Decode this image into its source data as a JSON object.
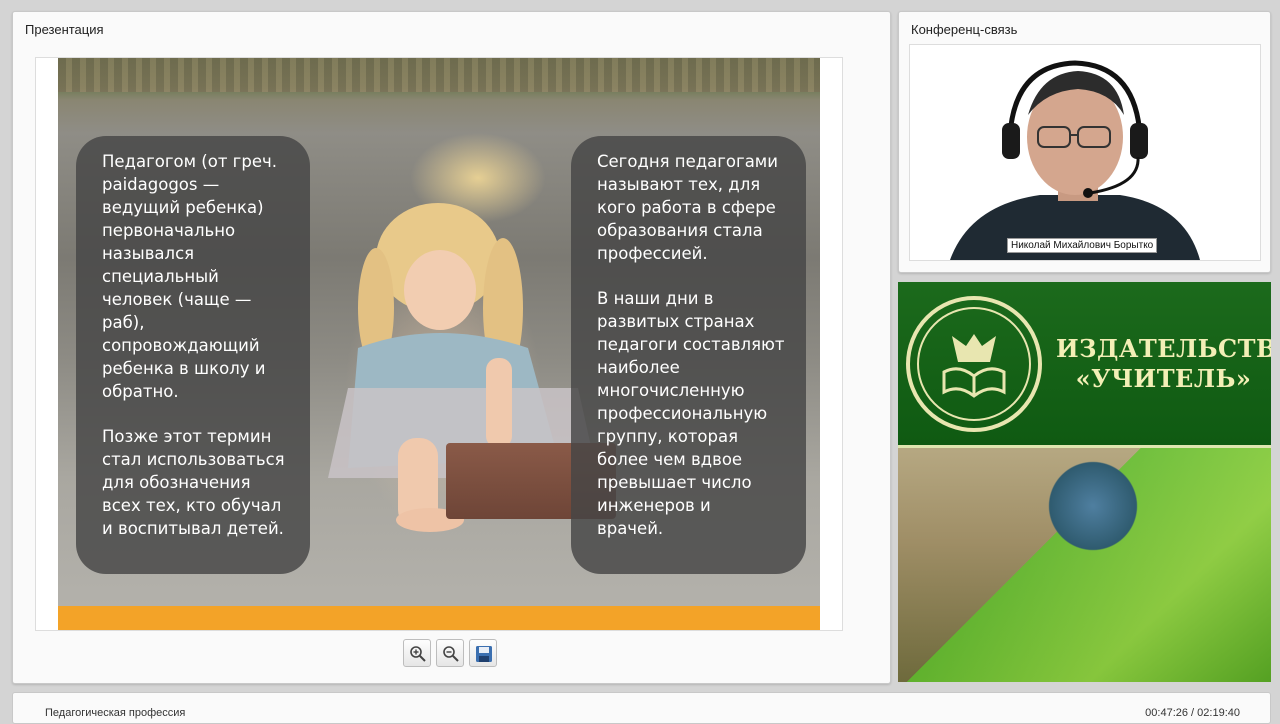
{
  "presentation": {
    "title": "Презентация",
    "slide": {
      "left_card": {
        "paragraph1": "Педагогом  (от греч.\npaidagogos —\nведущий ребенка)\nпервоначально\nназывался\nспециальный\nчеловек (чаще —\nраб),\nсопровождающий\nребенка в школу и\nобратно.",
        "paragraph2": "Позже этот термин\nстал использоваться\nдля обозначения\nвсех тех, кто обучал\nи воспитывал детей."
      },
      "right_card": {
        "paragraph1": "Сегодня педагогами\nназывают тех, для\nкого работа в сфере\nобразования стала\nпрофессией.",
        "paragraph2": "В наши дни в\nразвитых странах\nпедагоги составляют\nнаиболее\nмногочисленную\nпрофессиональную\nгруппу, которая\nболее чем вдвое\nпревышает число\nинженеров и\nврачей."
      },
      "accent_color": "#f3a328"
    },
    "toolbar": {
      "icons": [
        "zoom-in-icon",
        "zoom-out-icon",
        "save-icon"
      ]
    }
  },
  "conference": {
    "title": "Конференц-связь",
    "speaker_name": "Николай Михайлович Борытко"
  },
  "banner": {
    "title_line1": "ИЗДАТЕЛЬСТВО",
    "title_line2": "«УЧИТЕЛЬ»",
    "brand_color": "#0f5a12"
  },
  "footer": {
    "lecture_title": "Педагогическая профессия",
    "current_time": "00:47:26",
    "separator": " / ",
    "total_time": "02:19:40"
  }
}
